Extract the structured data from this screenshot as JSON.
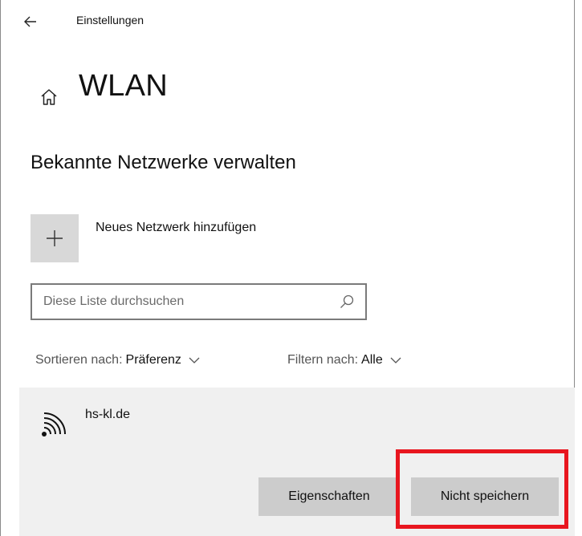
{
  "titlebar": {
    "back_icon": "arrow-left-icon",
    "app_title": "Einstellungen"
  },
  "header": {
    "home_icon": "home-icon",
    "title": "WLAN"
  },
  "section": {
    "title": "Bekannte Netzwerke verwalten"
  },
  "add_network": {
    "icon": "plus-icon",
    "label": "Neues Netzwerk hinzufügen"
  },
  "search": {
    "placeholder": "Diese Liste durchsuchen",
    "value": "",
    "icon": "search-icon"
  },
  "sort": {
    "label": "Sortieren nach:",
    "value": "Präferenz"
  },
  "filter": {
    "label": "Filtern nach:",
    "value": "Alle"
  },
  "networks": [
    {
      "name": "hs-kl.de",
      "icon": "wifi-icon",
      "actions": {
        "properties_label": "Eigenschaften",
        "forget_label": "Nicht speichern"
      }
    }
  ],
  "colors": {
    "highlight": "#e8161f",
    "item_background": "#f0f0f0",
    "button_background": "#cccccc"
  }
}
